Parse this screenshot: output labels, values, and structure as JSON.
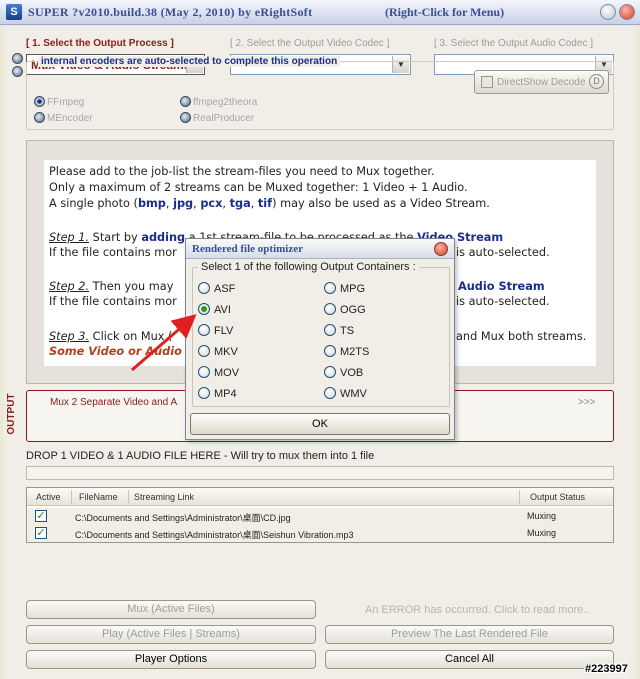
{
  "window": {
    "icon": "app-icon",
    "title": "SUPER ?v2010.build.38 (May 2, 2010) by eRightSoft",
    "hint": "(Right-Click for Menu)"
  },
  "steps": {
    "step1_label": "[ 1.        Select the Output Process ]",
    "step2_label": "[ 2.    Select the Output Video Codec ]",
    "step3_label": "[ 3.    Select the Output Audio Codec ]",
    "process_value": "Mux Video & Audio Streams",
    "video_codec_value": "",
    "audio_codec_value": ""
  },
  "encoders": {
    "title": "internal encoders are auto-selected to complete this operation",
    "options": [
      "FFmpeg",
      "ffmpeg2theora",
      "MEncoder",
      "RealProducer"
    ],
    "selected": "FFmpeg",
    "directshow_label": "DirectShow Decode",
    "directshow_badge": "D"
  },
  "instructions": {
    "line1": "Please add to the job-list the stream-files you need to Mux together.",
    "line2": "Only a maximum of 2 streams can be Muxed together:  1 Video + 1 Audio.",
    "line3_a": "A single photo (",
    "line3_bmp": "bmp",
    "line3_jpg": "jpg",
    "line3_pcx": "pcx",
    "line3_tga": "tga",
    "line3_tif": "tif",
    "line3_b": ") may also be used as a Video Stream.",
    "step1_tag": "Step 1.",
    "step1_text_a": " Start by ",
    "step1_adding": "adding",
    "step1_text_b": " a 1st stream-file to be processed as the ",
    "step1_vs": "Video Stream",
    "step1_line2": "If the file contains mor",
    "step1_line2_end": "is auto-selected.",
    "step2_tag": "Step 2.",
    "step2_text": " Then you may",
    "step2_as": "Audio Stream",
    "step2_line2": "If the file contains mor",
    "step2_line2_end": "is auto-selected.",
    "step3_tag": "Step 3.",
    "step3_text": " Click on Mux (",
    "step3_end": "and Mux both streams.",
    "warning": "Some Video or Audio"
  },
  "output": {
    "side_label": "OUTPUT",
    "text": "Mux 2 Separate Video and A",
    "more": ">>>"
  },
  "drop_label": "DROP 1 VIDEO & 1 AUDIO FILE HERE - Will try to mux them into 1 file",
  "job_list": {
    "columns": [
      "Active",
      "FileName",
      "Streaming Link",
      "Output Status"
    ],
    "rows": [
      {
        "path": "C:\\Documents and Settings\\Administrator\\桌面\\CD.jpg",
        "status": "Muxing"
      },
      {
        "path": "C:\\Documents and Settings\\Administrator\\桌面\\Seishun Vibration.mp3",
        "status": "Muxing"
      }
    ]
  },
  "buttons": {
    "mux": "Mux (Active Files)",
    "error": "An ERROR has occurred. Click to read more..",
    "play": "Play (Active Files | Streams)",
    "preview": "Preview The Last Rendered File",
    "player_options": "Player Options",
    "cancel_all": "Cancel All"
  },
  "dialog": {
    "title": "Rendered file optimizer",
    "group_title": "Select 1 of the following Output Containers :",
    "options_left": [
      "ASF",
      "AVI",
      "FLV",
      "MKV",
      "MOV",
      "MP4"
    ],
    "options_right": [
      "MPG",
      "OGG",
      "TS",
      "M2TS",
      "VOB",
      "WMV"
    ],
    "selected": "AVI",
    "ok_label": "OK"
  },
  "annotation": {
    "arrow_color": "#e02020"
  },
  "watermark": "#223997"
}
